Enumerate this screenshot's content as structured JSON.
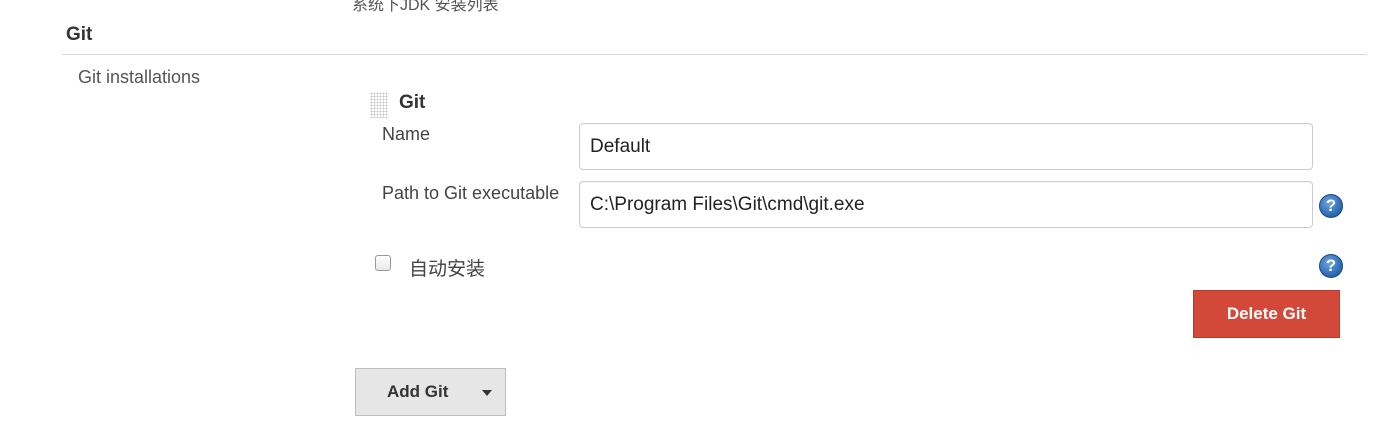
{
  "section_above": {
    "cut_description": "系统下JDK 安装列表"
  },
  "git_section": {
    "header": "Git",
    "field_label": "Git installations",
    "installation": {
      "title": "Git",
      "name_label": "Name",
      "name_value": "Default",
      "path_label": "Path to Git executable",
      "path_value": "C:\\Program Files\\Git\\cmd\\git.exe",
      "auto_install_label": "自动安装",
      "auto_install_checked": false,
      "help_glyph": "?",
      "delete_label": "Delete Git"
    },
    "add_button_label": "Add Git"
  },
  "colors": {
    "delete_button": "#d24939",
    "help_icon": "#2f6fb8",
    "add_button_bg": "#e6e6e6"
  },
  "icons": {
    "drag_handle": "drag-handle-icon",
    "help": "help-icon",
    "dropdown": "chevron-down-icon"
  }
}
